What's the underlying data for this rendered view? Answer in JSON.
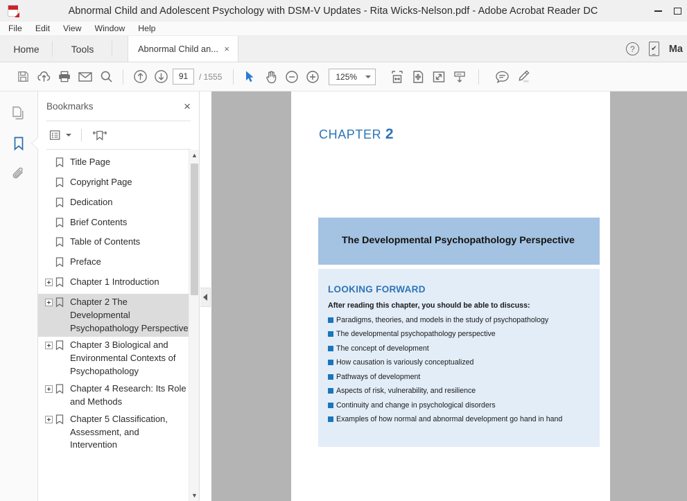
{
  "window": {
    "title": "Abnormal Child and Adolescent Psychology with DSM-V Updates - Rita Wicks-Nelson.pdf - Adobe Acrobat Reader DC",
    "app_icon": "pdf-document-icon",
    "minimize_label": "Minimize",
    "maximize_label": "Maximize"
  },
  "menubar": {
    "items": [
      {
        "label": "File"
      },
      {
        "label": "Edit"
      },
      {
        "label": "View"
      },
      {
        "label": "Window"
      },
      {
        "label": "Help"
      }
    ]
  },
  "tabstrip": {
    "home_label": "Home",
    "tools_label": "Tools",
    "doc_tab_label": "Abnormal Child an...",
    "doc_tab_close": "×",
    "help_icon": "question-mark-circle-icon",
    "mobile_icon": "mobile-device-check-icon",
    "signin_label": "Ma"
  },
  "toolbar": {
    "save_label": "Save file",
    "upload_label": "Save to cloud",
    "print_label": "Print file",
    "email_label": "Email file",
    "search_label": "Find",
    "prev_page_label": "Previous page",
    "next_page_label": "Next page",
    "page_number": "91",
    "page_count": "/ 1555",
    "select_tool_label": "Select tool",
    "hand_tool_label": "Hand tool",
    "zoom_out_label": "Zoom out",
    "zoom_in_label": "Zoom in",
    "zoom_level": "125%",
    "fit_width_label": "Fit width",
    "fit_page_label": "Fit page",
    "fullscreen_label": "Read mode",
    "scroll_label": "Show more tools",
    "comment_label": "Add comment",
    "highlight_label": "Highlight text"
  },
  "rail": {
    "pages_label": "Page thumbnails",
    "bookmarks_label": "Bookmarks",
    "attachments_label": "Attachments"
  },
  "panel": {
    "title": "Bookmarks",
    "close_label": "×",
    "options_label": "Options",
    "new_bookmark_label": "New bookmark",
    "collapse_label": "Collapse panel",
    "bookmarks": [
      {
        "label": "Title Page",
        "expandable": false,
        "selected": false
      },
      {
        "label": "Copyright Page",
        "expandable": false,
        "selected": false
      },
      {
        "label": "Dedication",
        "expandable": false,
        "selected": false
      },
      {
        "label": "Brief Contents",
        "expandable": false,
        "selected": false
      },
      {
        "label": "Table of Contents",
        "expandable": false,
        "selected": false
      },
      {
        "label": "Preface",
        "expandable": false,
        "selected": false
      },
      {
        "label": "Chapter 1 Introduction",
        "expandable": true,
        "selected": false
      },
      {
        "label": "Chapter 2 The Developmental Psychopathology Perspective",
        "expandable": true,
        "selected": true
      },
      {
        "label": "Chapter 3 Biological and Environmental Contexts of Psychopathology",
        "expandable": true,
        "selected": false
      },
      {
        "label": "Chapter 4 Research: Its Role and Methods",
        "expandable": true,
        "selected": false
      },
      {
        "label": "Chapter 5 Classification, Assessment, and Intervention",
        "expandable": true,
        "selected": false
      }
    ]
  },
  "document": {
    "chapter_prefix": "CHAPTER",
    "chapter_number": "2",
    "chapter_title": "The Developmental Psychopathology Perspective",
    "looking_forward_title": "LOOKING FORWARD",
    "looking_forward_intro": "After reading this chapter, you should be able to discuss:",
    "looking_forward_items": [
      "Paradigms, theories, and models in the study of psychopathology",
      "The developmental psychopathology perspective",
      "The concept of development",
      "How causation is variously conceptualized",
      "Pathways of development",
      "Aspects of risk, vulnerability, and resilience",
      "Continuity and change in psychological disorders",
      "Examples of how normal and abnormal development go hand in hand"
    ]
  },
  "colors": {
    "accent_blue": "#2e75b6",
    "header_box": "#a4c2e2",
    "panel_box": "#e3edf8",
    "bullet": "#1a76bc",
    "active_rail": "#2b6cb0"
  }
}
